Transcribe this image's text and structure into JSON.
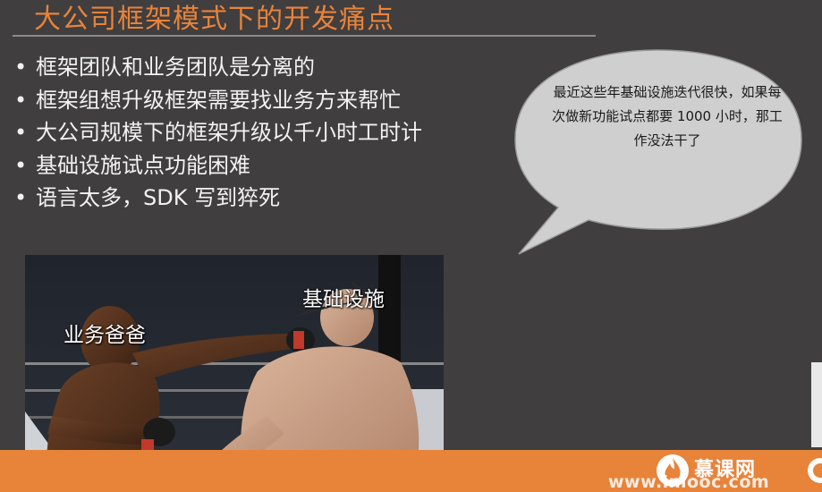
{
  "slide": {
    "title": "大公司框架模式下的开发痛点",
    "bullet_marker": "•",
    "bullets": [
      {
        "text": "框架团队和业务团队是分离的"
      },
      {
        "text": "框架组想升级框架需要找业务方来帮忙"
      },
      {
        "text": "大公司规模下的框架升级以千小时工时计"
      },
      {
        "text": "基础设施试点功能困难"
      },
      {
        "text": "语言太多，SDK 写到猝死"
      }
    ],
    "speech_bubble": "最近这些年基础设施迭代很快，如果每次做新功能试点都要 1000 小时，那工作没法干了",
    "photo": {
      "label_left": "业务爸爸",
      "label_right": "基础设施"
    }
  },
  "footer": {
    "logo_text": "慕课网",
    "logo_url": "www.imooc.com",
    "accent_color": "#e8833a"
  }
}
